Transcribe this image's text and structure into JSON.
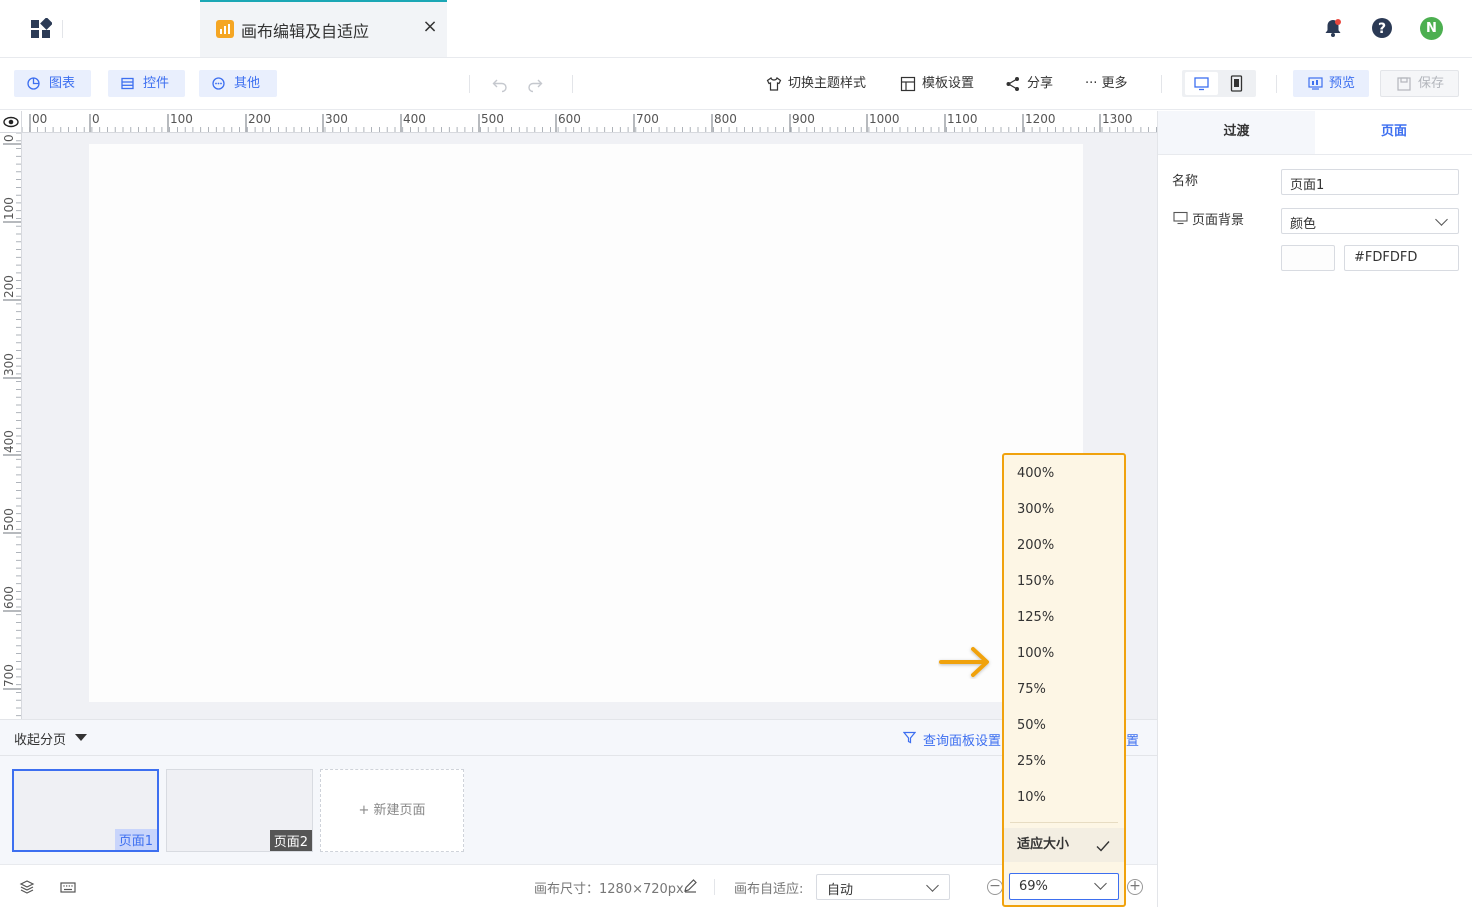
{
  "header": {
    "tab_title": "画布编辑及自适应",
    "tab_close": "×",
    "avatar_letter": "N"
  },
  "toolbar": {
    "charts": "图表",
    "controls": "控件",
    "other": "其他",
    "theme": "切换主题样式",
    "template": "模板设置",
    "share": "分享",
    "more": "··· 更多",
    "preview": "预览",
    "save": "保存"
  },
  "ruler": {
    "top_ticks": [
      "00",
      "0",
      "100",
      "200",
      "300",
      "400",
      "500",
      "600",
      "700",
      "800",
      "900",
      "1000",
      "1100",
      "1200",
      "1300"
    ],
    "left_ticks": [
      "0",
      "100",
      "200",
      "300",
      "400",
      "500",
      "600",
      "700"
    ]
  },
  "pagebar": {
    "collapse": "收起分页",
    "query_settings": "查询面板设置",
    "settings_tail": "置",
    "pages": [
      {
        "label": "页面1",
        "active": true
      },
      {
        "label": "页面2",
        "active": false
      }
    ],
    "new_page": "+ 新建页面"
  },
  "statusbar": {
    "canvas_size": "画布尺寸：1280×720px",
    "adapt_label": "画布自适应:",
    "adapt_value": "自动",
    "zoom_value": "69%"
  },
  "zoom_menu": {
    "options": [
      "400%",
      "300%",
      "200%",
      "150%",
      "125%",
      "100%",
      "75%",
      "50%",
      "25%",
      "10%"
    ],
    "fit": "适应大小"
  },
  "right_panel": {
    "tabs": [
      "过渡",
      "页面"
    ],
    "name_label": "名称",
    "name_value": "页面1",
    "bg_label": "页面背景",
    "bg_type": "颜色",
    "bg_color": "#FDFDFD"
  },
  "colors": {
    "accent": "#3D6FF0",
    "highlight": "#F0A20D",
    "tab_icon": "#F5A623",
    "avatar": "#4CAF50"
  }
}
